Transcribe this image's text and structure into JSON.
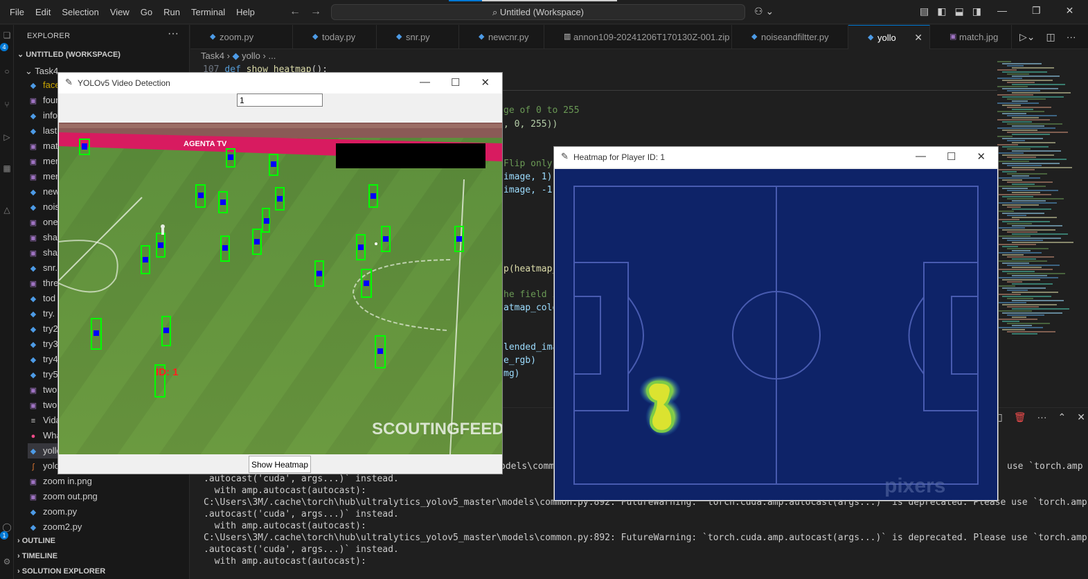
{
  "menu": [
    "File",
    "Edit",
    "Selection",
    "View",
    "Go",
    "Run",
    "Terminal",
    "Help"
  ],
  "search": {
    "label": "Untitled (Workspace)"
  },
  "sidebar": {
    "title": "EXPLORER",
    "workspace": "UNTITLED (WORKSPACE)",
    "folder": "Task4",
    "files": [
      "face",
      "four",
      "info",
      "last",
      "mat",
      "mer",
      "mer",
      "new",
      "nois",
      "one",
      "shal",
      "shal",
      "snr.",
      "thre",
      "tod",
      "try.",
      "try2",
      "try3",
      "try4",
      "try5",
      "two",
      "two",
      "Vida",
      "Wha",
      "yollo",
      "yolo",
      "zoom in.png",
      "zoom out.png",
      "zoom.py",
      "zoom2.py"
    ],
    "sections": [
      "OUTLINE",
      "TIMELINE",
      "SOLUTION EXPLORER"
    ],
    "activity_badges": [
      "4",
      "1"
    ]
  },
  "tabs": [
    "zoom.py",
    "today.py",
    "snr.py",
    "newcnr.py",
    "annon109-20241206T170130Z-001.zip",
    "noiseandfiltter.py",
    "yollo",
    "match.jpg"
  ],
  "breadcrumb": [
    "Task4",
    "yollo",
    "..."
  ],
  "editor": {
    "line_number": "107",
    "visible_line": {
      "keyword": "def",
      "name": "show_heatmap",
      "rest": "():"
    },
    "fragments": [
      "ge of 0 to 255",
      ", 0, 255))",
      "Flip only",
      "image, 1)",
      "image, -1)",
      "p(heatmap_",
      "he field i",
      "atmap_colo",
      "lended_ima",
      "e_rgb)",
      "mg)"
    ]
  },
  "terminal": {
    "lines": [
      "odels\\commo",
      ".autocast('cuda', args...)` instead.",
      "  with amp.autocast(autocast):",
      "C:\\Users\\3M/.cache\\torch\\hub\\ultralytics_yolov5_master\\models\\common.py:892: FutureWarning: `torch.cuda.amp.autocast(args...)` is deprecated. Please use `torch.amp",
      ".autocast('cuda', args...)` instead.",
      "  with amp.autocast(autocast):",
      "C:\\Users\\3M/.cache\\torch\\hub\\ultralytics_yolov5_master\\models\\common.py:892: FutureWarning: `torch.cuda.amp.autocast(args...)` is deprecated. Please use `torch.amp",
      ".autocast('cuda', args...)` instead.",
      "  with amp.autocast(autocast):"
    ],
    "right_fragment": "use `torch.amp"
  },
  "yolo_window": {
    "title": "YOLOv5 Video Detection",
    "input_value": "1",
    "button": "Show Heatmap",
    "banner_text": "AGENTA TV",
    "watermark": "SCOUTINGFEED",
    "id_label": "ID: 1"
  },
  "heatmap_window": {
    "title": "Heatmap for Player ID: 1",
    "watermark": "pixers"
  }
}
